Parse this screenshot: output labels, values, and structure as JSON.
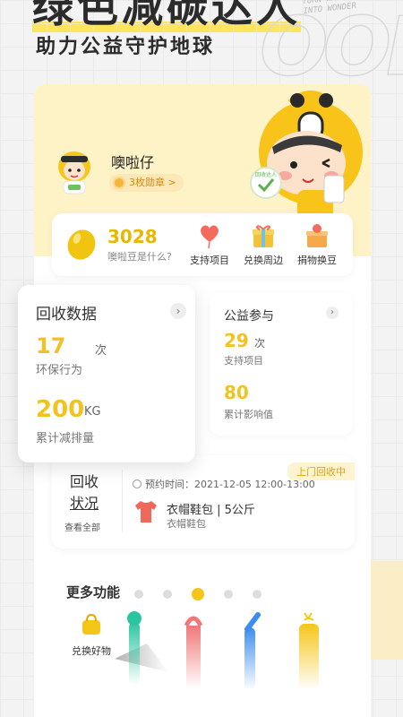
{
  "hero": {
    "title": "绿色减碳达人",
    "subtitle": "助力公益守护地球",
    "deco_line1": "TURN WASTE",
    "deco_line2": "INTO WONDER"
  },
  "user": {
    "name": "噢啦仔",
    "badges": "3枚勋章 >",
    "mascot_badge": "回收达人"
  },
  "points": {
    "value": "3028",
    "help": "噢啦豆是什么?",
    "actions": [
      {
        "label": "支持项目",
        "icon": "heart-balloon-icon"
      },
      {
        "label": "兑换周边",
        "icon": "gift-box-icon"
      },
      {
        "label": "捐物换豆",
        "icon": "donation-box-icon"
      }
    ]
  },
  "recycle": {
    "title": "回收数据",
    "count_value": "17",
    "count_unit": "次",
    "count_label": "环保行为",
    "emission_value": "200",
    "emission_unit": "KG",
    "emission_label": "累计减排量"
  },
  "charity": {
    "title": "公益参与",
    "projects_value": "29",
    "projects_unit": "次",
    "projects_label": "支持项目",
    "impact_value": "80",
    "impact_label": "累计影响值"
  },
  "status": {
    "title_line1": "回收",
    "title_line2": "状况",
    "view_all": "查看全部",
    "tag": "上门回收中",
    "time": "预约时间：2021-12-05  12:00-13:00",
    "item_main": "衣帽鞋包 | 5公斤",
    "item_sub": "衣帽鞋包"
  },
  "more": {
    "title": "更多功能",
    "first_item": "兑换好物",
    "carousel_page": 3,
    "carousel_total": 5
  },
  "colors": {
    "accent": "#f5c518",
    "card_yellow": "#fdf3c7",
    "status_orange": "#e2a20c"
  }
}
